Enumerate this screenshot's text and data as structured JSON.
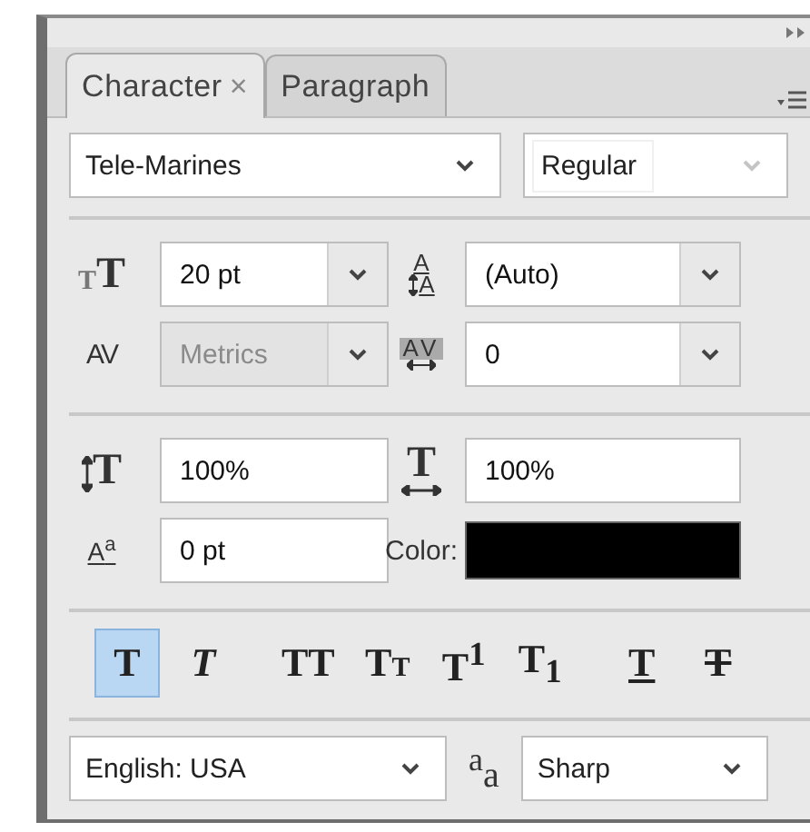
{
  "tabs": [
    {
      "label": "Character",
      "selected": true,
      "close": "×"
    },
    {
      "label": "Paragraph",
      "selected": false
    }
  ],
  "font": {
    "family": "Tele-Marines",
    "style": "Regular",
    "style_disabled": true
  },
  "rows": [
    [
      {
        "kind": "size",
        "glyph": "TT",
        "value": "20 pt",
        "dropdown": true,
        "disabled": false
      },
      {
        "kind": "leading",
        "glyph": "AA",
        "value": "(Auto)",
        "dropdown": true,
        "disabled": false
      }
    ],
    [
      {
        "kind": "kerning",
        "glyph": "AV",
        "value": "Metrics",
        "dropdown": true,
        "disabled": true
      },
      {
        "kind": "tracking",
        "glyph": "AV",
        "value": "0",
        "dropdown": true,
        "disabled": false
      }
    ],
    [
      {
        "kind": "vscale",
        "glyph": "T",
        "value": "100%",
        "dropdown": false,
        "disabled": false
      },
      {
        "kind": "hscale",
        "glyph": "T",
        "value": "100%",
        "dropdown": false,
        "disabled": false
      }
    ],
    [
      {
        "kind": "baseline",
        "glyph": "A$^{a}$",
        "value": "0 pt",
        "dropdown": false,
        "disabled": false
      },
      {
        "kind": "color",
        "label": "Color:",
        "color": "#000000"
      }
    ]
  ],
  "styles": [
    {
      "kind": "bold",
      "label": "T",
      "selected": true
    },
    {
      "kind": "italic",
      "label": "T",
      "selected": false
    },
    {
      "kind": "allcaps",
      "label": "TT",
      "selected": false
    },
    {
      "kind": "smallcaps",
      "label": "TT",
      "selected": false
    },
    {
      "kind": "super",
      "label": "T$^{1}$",
      "selected": false
    },
    {
      "kind": "sub",
      "label": "T$_{1}$",
      "selected": false
    },
    {
      "kind": "underline",
      "label": "T",
      "selected": false
    },
    {
      "kind": "strike",
      "label": "T",
      "selected": false
    }
  ],
  "language": "English: USA",
  "antialias": {
    "glyph": "aa",
    "value": "Sharp"
  }
}
